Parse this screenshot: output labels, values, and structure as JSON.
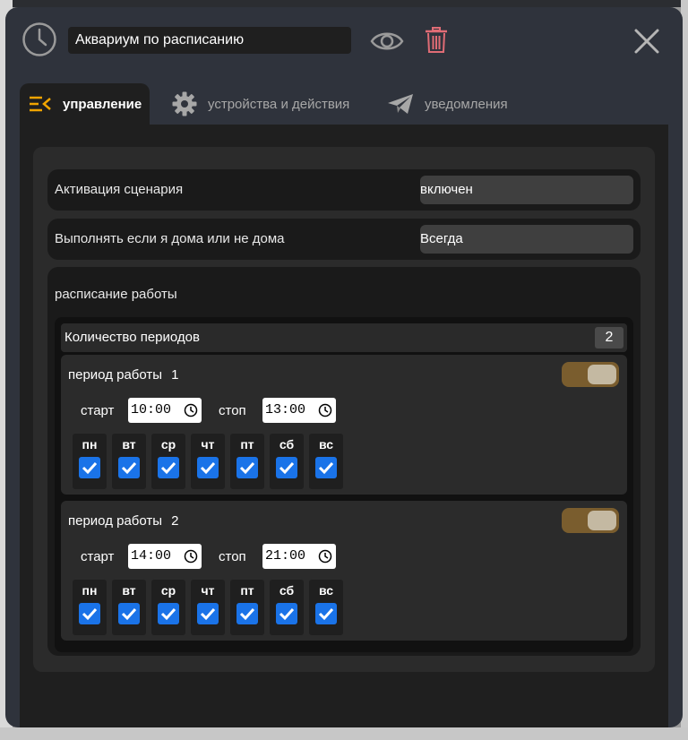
{
  "header": {
    "scenario_name": "Аквариум по расписанию"
  },
  "tabs": [
    {
      "label": "управление",
      "icon": "menu-collapse-icon",
      "active": true
    },
    {
      "label": "устройства и действия",
      "icon": "gear-icon",
      "active": false
    },
    {
      "label": "уведомления",
      "icon": "paper-plane-icon",
      "active": false
    }
  ],
  "settings": [
    {
      "label": "Активация сценария",
      "value": "включен"
    },
    {
      "label": "Выполнять если я дома или не дома",
      "value": "Всегда"
    }
  ],
  "schedule": {
    "label": "расписание работы",
    "count_label": "Количество периодов",
    "count_value": "2",
    "periods": [
      {
        "title": "период работы",
        "number": "1",
        "enabled": true,
        "start_label": "старт",
        "start": "10:00",
        "stop_label": "стоп",
        "stop": "13:00",
        "days": [
          "пн",
          "вт",
          "ср",
          "чт",
          "пт",
          "сб",
          "вс"
        ]
      },
      {
        "title": "период работы",
        "number": "2",
        "enabled": true,
        "start_label": "старт",
        "start": "14:00",
        "stop_label": "стоп",
        "stop": "21:00",
        "days": [
          "пн",
          "вт",
          "ср",
          "чт",
          "пт",
          "сб",
          "вс"
        ]
      }
    ]
  },
  "colors": {
    "accent": "#f0a400",
    "trash": "#e06c75",
    "toggle_on": "#7a5d2e",
    "checkbox": "#1a73e8"
  }
}
